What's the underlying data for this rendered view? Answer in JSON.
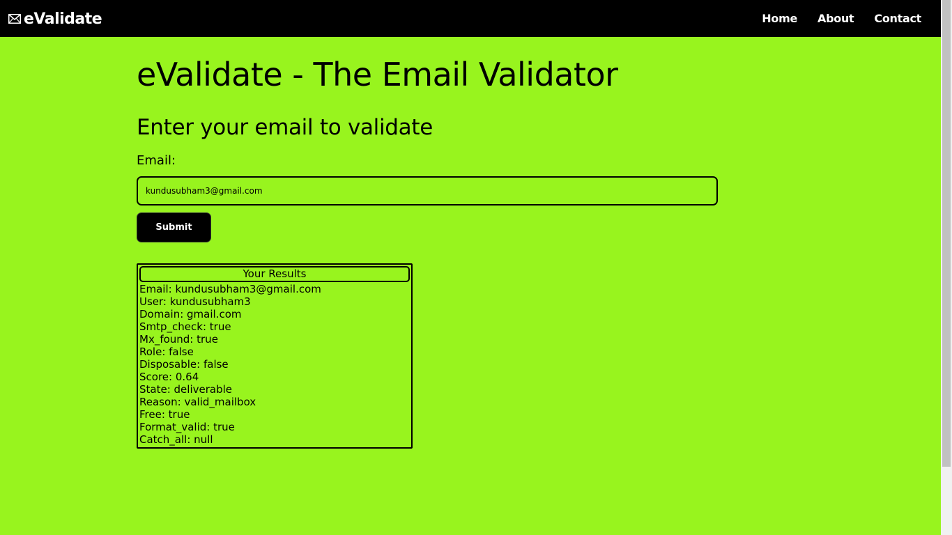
{
  "navbar": {
    "brand": "eValidate",
    "brand_icon": "envelope-icon",
    "links": [
      {
        "label": "Home"
      },
      {
        "label": "About"
      },
      {
        "label": "Contact"
      }
    ]
  },
  "main": {
    "title": "eValidate - The Email Validator",
    "subtitle": "Enter your email to validate",
    "email_label": "Email:",
    "email_value": "kundusubham3@gmail.com",
    "submit_label": "Submit"
  },
  "results": {
    "title": "Your Results",
    "lines": [
      "Email: kundusubham3@gmail.com",
      "User: kundusubham3",
      "Domain: gmail.com",
      "Smtp_check: true",
      "Mx_found: true",
      "Role: false",
      "Disposable: false",
      "Score: 0.64",
      "State: deliverable",
      "Reason: valid_mailbox",
      "Free: true",
      "Format_valid: true",
      "Catch_all: null"
    ]
  },
  "colors": {
    "background": "#98f41e",
    "navbar": "#000000",
    "text": "#000000"
  }
}
